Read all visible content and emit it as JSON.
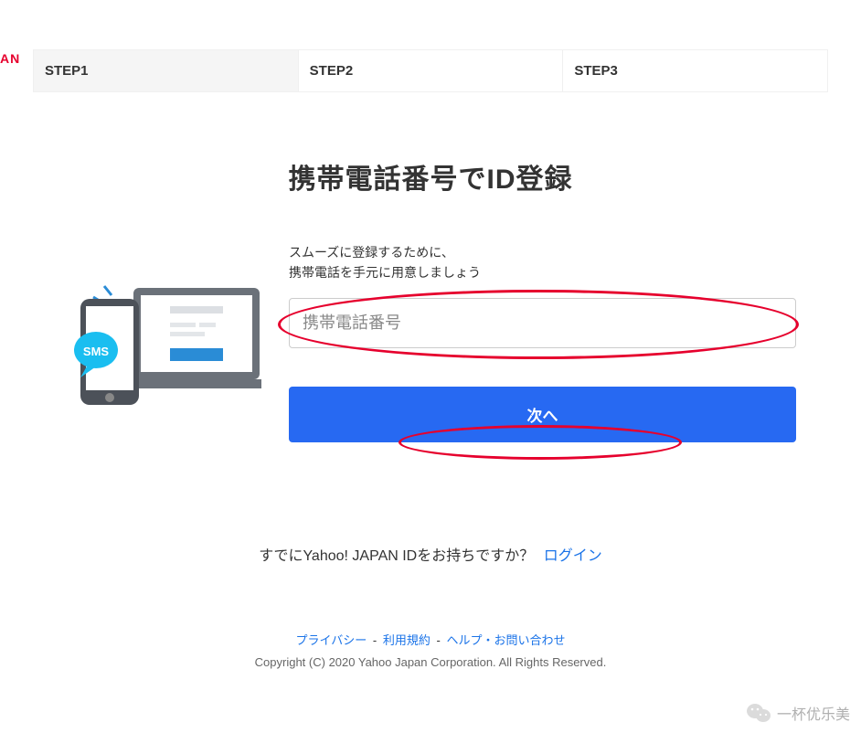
{
  "logo_fragment": "AN",
  "steps": {
    "items": [
      {
        "label": "STEP1",
        "active": true
      },
      {
        "label": "STEP2",
        "active": false
      },
      {
        "label": "STEP3",
        "active": false
      }
    ]
  },
  "main": {
    "title": "携帯電話番号でID登録",
    "instruction_line1": "スムーズに登録するために、",
    "instruction_line2": "携帯電話を手元に用意しましょう",
    "phone_placeholder": "携帯電話番号",
    "next_label": "次へ"
  },
  "already": {
    "text": "すでにYahoo! JAPAN IDをお持ちですか？",
    "login_label": "ログイン"
  },
  "footer": {
    "links": {
      "privacy": "プライバシー",
      "terms": "利用規約",
      "help": "ヘルプ・お問い合わせ"
    },
    "copyright": "Copyright (C) 2020 Yahoo Japan Corporation. All Rights Reserved."
  },
  "watermark": {
    "text": "一杯优乐美"
  }
}
